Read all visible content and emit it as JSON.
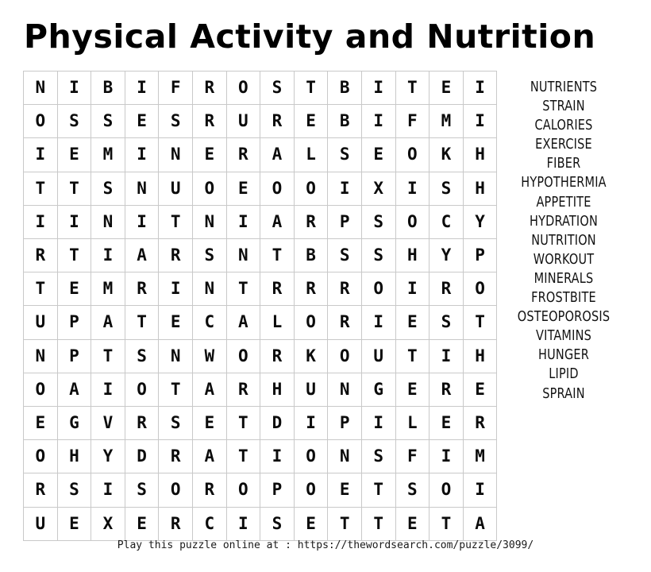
{
  "title": "Physical Activity and Nutrition",
  "grid": {
    "rows": 14,
    "cols": 14,
    "letters": [
      [
        "N",
        "I",
        "B",
        "I",
        "F",
        "R",
        "O",
        "S",
        "T",
        "B",
        "I",
        "T",
        "E",
        "I"
      ],
      [
        "O",
        "S",
        "S",
        "E",
        "S",
        "R",
        "U",
        "R",
        "E",
        "B",
        "I",
        "F",
        "M",
        "I"
      ],
      [
        "I",
        "E",
        "M",
        "I",
        "N",
        "E",
        "R",
        "A",
        "L",
        "S",
        "E",
        "O",
        "K",
        "H"
      ],
      [
        "T",
        "T",
        "S",
        "N",
        "U",
        "O",
        "E",
        "O",
        "O",
        "I",
        "X",
        "I",
        "S",
        "H"
      ],
      [
        "I",
        "I",
        "N",
        "I",
        "T",
        "N",
        "I",
        "A",
        "R",
        "P",
        "S",
        "O",
        "C",
        "Y"
      ],
      [
        "R",
        "T",
        "I",
        "A",
        "R",
        "S",
        "N",
        "T",
        "B",
        "S",
        "S",
        "H",
        "Y",
        "P"
      ],
      [
        "T",
        "E",
        "M",
        "R",
        "I",
        "N",
        "T",
        "R",
        "R",
        "R",
        "O",
        "I",
        "R",
        "O"
      ],
      [
        "U",
        "P",
        "A",
        "T",
        "E",
        "C",
        "A",
        "L",
        "O",
        "R",
        "I",
        "E",
        "S",
        "T"
      ],
      [
        "N",
        "P",
        "T",
        "S",
        "N",
        "W",
        "O",
        "R",
        "K",
        "O",
        "U",
        "T",
        "I",
        "H"
      ],
      [
        "O",
        "A",
        "I",
        "O",
        "T",
        "A",
        "R",
        "H",
        "U",
        "N",
        "G",
        "E",
        "R",
        "E"
      ],
      [
        "E",
        "G",
        "V",
        "R",
        "S",
        "E",
        "T",
        "D",
        "I",
        "P",
        "I",
        "L",
        "E",
        "R"
      ],
      [
        "O",
        "H",
        "Y",
        "D",
        "R",
        "A",
        "T",
        "I",
        "O",
        "N",
        "S",
        "F",
        "I",
        "M"
      ],
      [
        "R",
        "S",
        "I",
        "S",
        "O",
        "R",
        "O",
        "P",
        "O",
        "E",
        "T",
        "S",
        "O",
        "I"
      ],
      [
        "U",
        "E",
        "X",
        "E",
        "R",
        "C",
        "I",
        "S",
        "E",
        "T",
        "T",
        "E",
        "T",
        "A"
      ]
    ]
  },
  "word_list": {
    "words": [
      "NUTRIENTS",
      "STRAIN",
      "CALORIES",
      "EXERCISE",
      "FIBER",
      "HYPOTHERMIA",
      "APPETITE",
      "HYDRATION",
      "NUTRITION",
      "WORKOUT",
      "MINERALS",
      "FROSTBITE",
      "OSTEOPOROSIS",
      "VITAMINS",
      "HUNGER",
      "LIPID",
      "SPRAIN"
    ]
  },
  "footer": {
    "text": "Play this puzzle online at : https://thewordsearch.com/puzzle/3099/"
  },
  "colors": {
    "text": "#000000",
    "grid_border": "#c9c9c9",
    "background": "#ffffff"
  }
}
